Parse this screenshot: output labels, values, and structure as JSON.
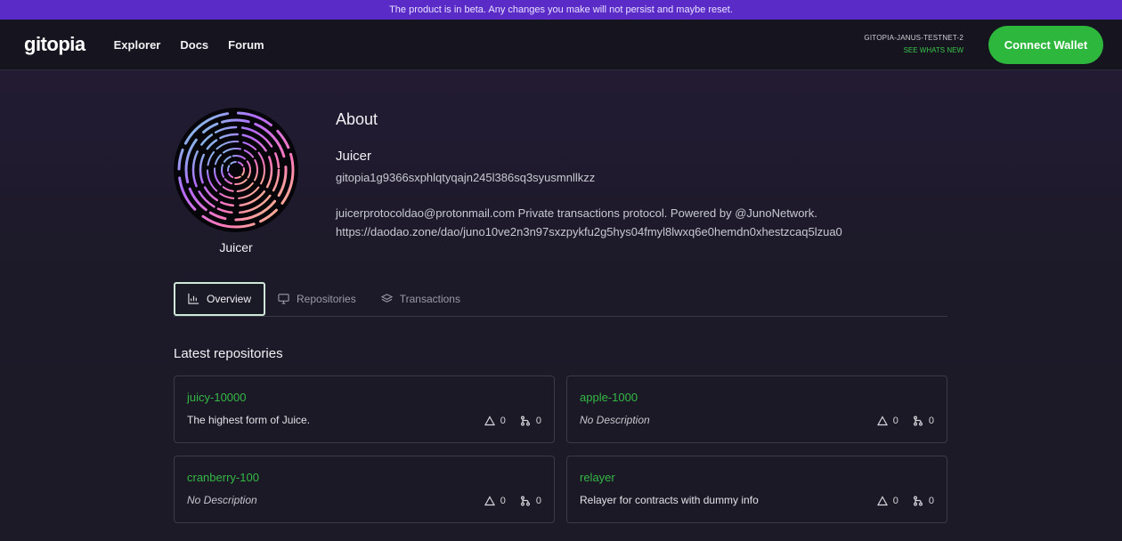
{
  "banner": {
    "text": "The product is in beta. Any changes you make will not persist and maybe reset."
  },
  "nav": {
    "logo": "gitopia",
    "links": [
      "Explorer",
      "Docs",
      "Forum"
    ],
    "network": "GITOPIA-JANUS-TESTNET-2",
    "whats_new": "SEE WHATS NEW",
    "connect": "Connect Wallet"
  },
  "profile": {
    "avatar_name": "Juicer",
    "about_title": "About",
    "name": "Juicer",
    "address": "gitopia1g9366sxphlqtyqajn245l386sq3syusmnllkzz",
    "bio_line1": "juicerprotocoldao@protonmail.com Private transactions protocol. Powered by @JunoNetwork.",
    "bio_line2": "https://daodao.zone/dao/juno10ve2n3n97sxzpykfu2g5hys04fmyl8lwxq6e0hemdn0xhestzcaq5lzua0"
  },
  "tabs": [
    {
      "label": "Overview",
      "icon": "chart-icon"
    },
    {
      "label": "Repositories",
      "icon": "monitor-icon"
    },
    {
      "label": "Transactions",
      "icon": "layers-icon"
    }
  ],
  "latest_title": "Latest repositories",
  "repos": [
    {
      "name": "juicy-10000",
      "description": "The highest form of Juice.",
      "issues": "0",
      "forks": "0",
      "italic": false
    },
    {
      "name": "apple-1000",
      "description": "No Description",
      "issues": "0",
      "forks": "0",
      "italic": true
    },
    {
      "name": "cranberry-100",
      "description": "No Description",
      "issues": "0",
      "forks": "0",
      "italic": true
    },
    {
      "name": "relayer",
      "description": "Relayer for contracts with dummy info",
      "issues": "0",
      "forks": "0",
      "italic": false
    }
  ],
  "colors": {
    "accent": "#2db83d",
    "banner": "#5b2bc7",
    "background": "#1b1a26"
  }
}
